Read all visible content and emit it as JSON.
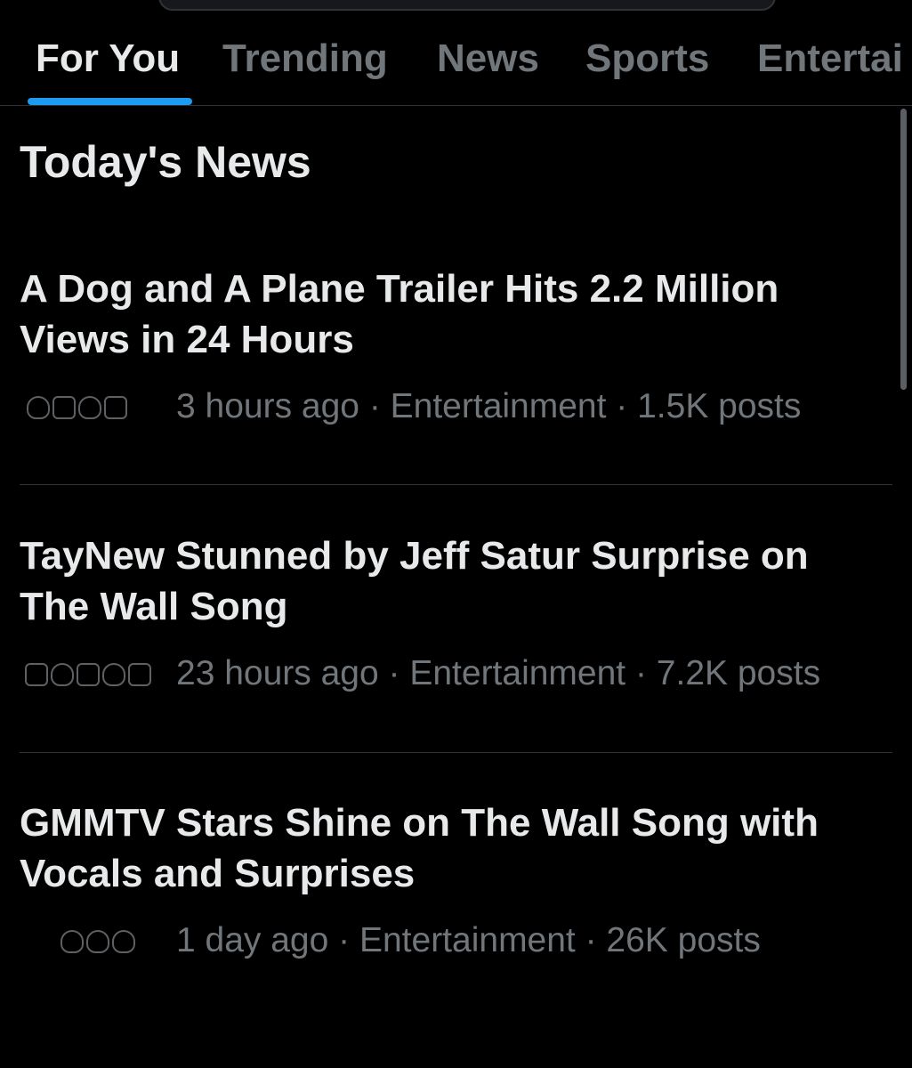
{
  "tabs": [
    {
      "label": "For You",
      "active": true
    },
    {
      "label": "Trending",
      "active": false
    },
    {
      "label": "News",
      "active": false
    },
    {
      "label": "Sports",
      "active": false
    },
    {
      "label": "Entertai",
      "active": false
    }
  ],
  "section": {
    "title": "Today's News"
  },
  "news": [
    {
      "headline": "A Dog and A Plane Trailer Hits 2.2 Million Views in 24 Hours",
      "meta": "3 hours ago · Entertainment · 1.5K posts"
    },
    {
      "headline": "TayNew Stunned by Jeff Satur Surprise on The Wall Song",
      "meta": "23 hours ago · Entertainment · 7.2K posts"
    },
    {
      "headline": "GMMTV Stars Shine on The Wall Song with Vocals and Surprises",
      "meta": "1 day ago · Entertainment · 26K posts"
    }
  ],
  "colors": {
    "background": "#000000",
    "text_primary": "#e7e9ea",
    "text_secondary": "#71767b",
    "accent": "#1d9bf0",
    "divider": "#2f3336"
  }
}
